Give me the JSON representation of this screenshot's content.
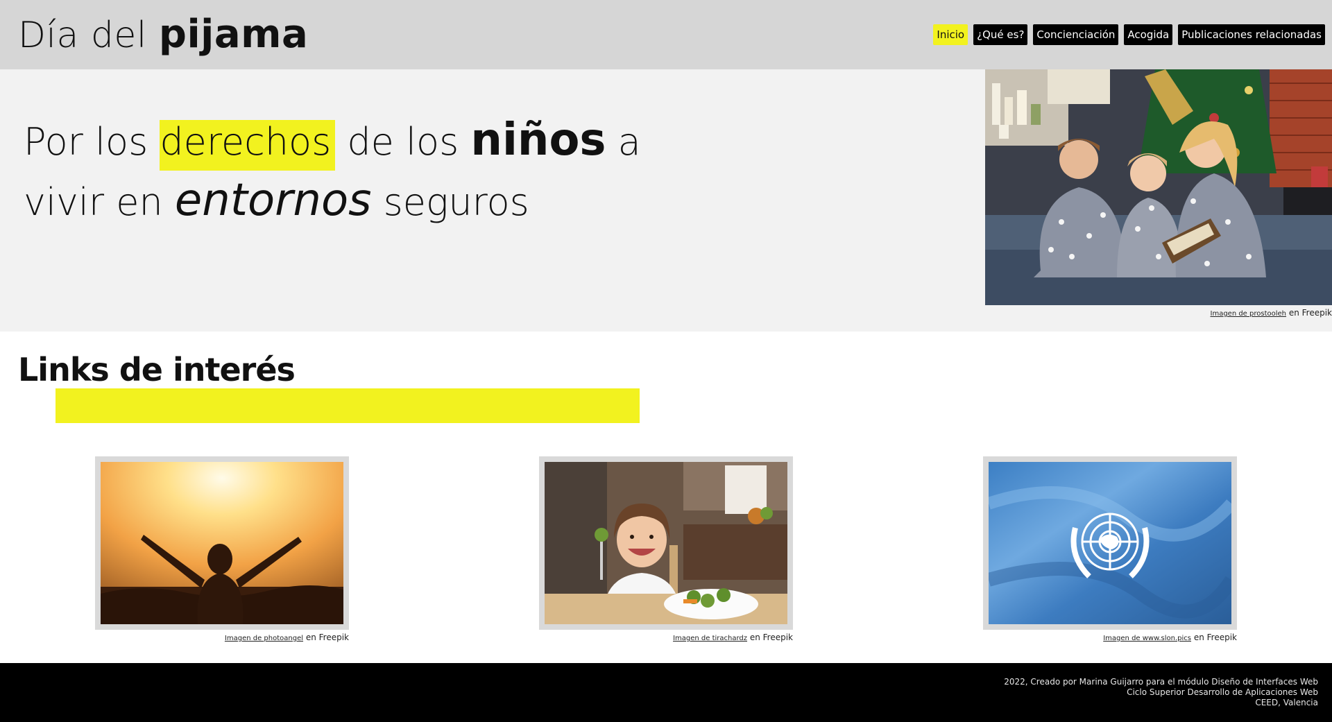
{
  "header": {
    "logo_light": "Día del",
    "logo_bold": "pijama",
    "nav": [
      {
        "label": "Inicio",
        "active": true
      },
      {
        "label": "¿Qué es?",
        "active": false
      },
      {
        "label": "Concienciación",
        "active": false
      },
      {
        "label": "Acogida",
        "active": false
      },
      {
        "label": "Publicaciones relacionadas",
        "active": false
      }
    ]
  },
  "hero": {
    "t1": "Por los ",
    "t2": "derechos",
    "t3": " de los ",
    "t4": "niños",
    "t5": " a",
    "t6": "vivir en ",
    "t7": "entornos",
    "t8": " seguros",
    "photo_icon": "family-reading-christmas-photo",
    "credit_link": "Imagen de prostooleh",
    "credit_suffix": " en Freepik"
  },
  "links": {
    "title": "Links de interés",
    "cards": [
      {
        "icon": "sunset-arms-raised-photo",
        "credit_link": "Imagen de photoangel",
        "credit_suffix": " en Freepik"
      },
      {
        "icon": "girl-eating-vegetables-photo",
        "credit_link": "Imagen de tirachardz",
        "credit_suffix": " en Freepik"
      },
      {
        "icon": "united-nations-flag-photo",
        "credit_link": "Imagen de www.slon.pics",
        "credit_suffix": " en Freepik"
      }
    ]
  },
  "footer": {
    "line1": "2022, Creado por Marina Guijarro para el módulo Diseño de Interfaces Web",
    "line2": "Ciclo Superior Desarrollo de Aplicaciones Web",
    "line3": "CEED, Valencia"
  },
  "colors": {
    "accent_yellow": "#f2f21f",
    "header_bg": "#d6d6d6",
    "hero_bg": "#f2f2f2",
    "footer_bg": "#000000"
  }
}
